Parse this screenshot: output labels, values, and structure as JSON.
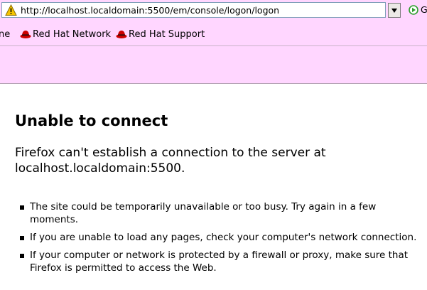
{
  "urlbar": {
    "url": "http://localhost.localdomain:5500/em/console/logon/logon",
    "warning_icon": "warning-triangle-icon",
    "go_label": "Go"
  },
  "bookmarks": {
    "partial_item": "ne",
    "items": [
      {
        "label": "Red Hat Network",
        "icon": "redhat-icon"
      },
      {
        "label": "Red Hat Support",
        "icon": "redhat-icon"
      }
    ]
  },
  "error": {
    "title": "Unable to connect",
    "description": "Firefox can't establish a connection to the server at localhost.localdomain:5500.",
    "tips": [
      "The site could be temporarily unavailable or too busy. Try again in a few moments.",
      "If you are unable to load any pages, check your computer's network connection.",
      "If your computer or network is protected by a firewall or proxy, make sure that Firefox is permitted to access the Web."
    ]
  },
  "colors": {
    "toolbar_bg": "#ffd6ff",
    "page_bg": "#ffffff",
    "warning": "#f5c400",
    "go_green": "#2e9e2e",
    "redhat_red": "#cc0000"
  }
}
